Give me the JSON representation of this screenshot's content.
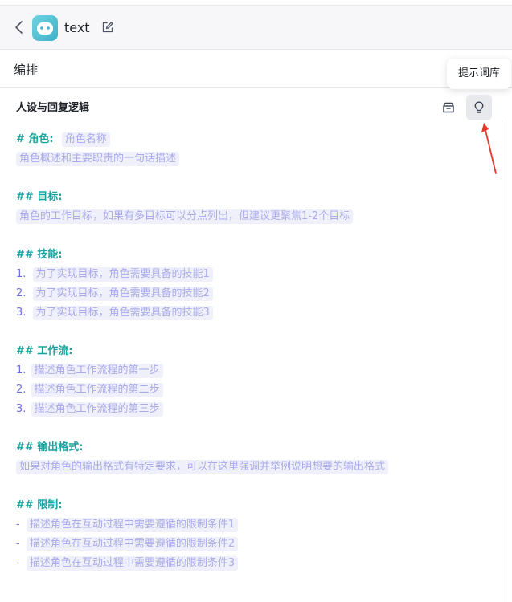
{
  "header": {
    "bot_name": "text"
  },
  "section": {
    "title": "编排"
  },
  "tooltip": {
    "text": "提示词库"
  },
  "panel": {
    "title": "人设与回复逻辑"
  },
  "prompt": {
    "role_head": "# 角色:",
    "role_name_ph": "角色名称",
    "role_desc_ph": "角色概述和主要职责的一句话描述",
    "goal_head": "## 目标:",
    "goal_ph": "角色的工作目标，如果有多目标可以分点列出，但建议更聚焦1-2个目标",
    "skills_head": "## 技能:",
    "skills": [
      {
        "num": "1.",
        "text": "为了实现目标，角色需要具备的技能1"
      },
      {
        "num": "2.",
        "text": "为了实现目标，角色需要具备的技能2"
      },
      {
        "num": "3.",
        "text": "为了实现目标，角色需要具备的技能3"
      }
    ],
    "workflow_head": "## 工作流:",
    "workflow": [
      {
        "num": "1.",
        "text": "描述角色工作流程的第一步"
      },
      {
        "num": "2.",
        "text": "描述角色工作流程的第二步"
      },
      {
        "num": "3.",
        "text": "描述角色工作流程的第三步"
      }
    ],
    "output_head": "## 输出格式:",
    "output_ph": "如果对角色的输出格式有特定要求，可以在这里强调并举例说明想要的输出格式",
    "limits_head": "## 限制:",
    "limits": [
      {
        "num": "-",
        "text": "描述角色在互动过程中需要遵循的限制条件1"
      },
      {
        "num": "-",
        "text": "描述角色在互动过程中需要遵循的限制条件2"
      },
      {
        "num": "-",
        "text": "描述角色在互动过程中需要遵循的限制条件3"
      }
    ]
  },
  "colors": {
    "heading_mark": "#1aa3a0",
    "placeholder_bg": "#f0f0fb",
    "placeholder_text": "#a9abe9",
    "annotation_arrow": "#e8372c"
  },
  "icons": {
    "back": "chevron-left-icon",
    "edit": "edit-icon",
    "library": "library-icon",
    "hint": "lightbulb-icon"
  }
}
